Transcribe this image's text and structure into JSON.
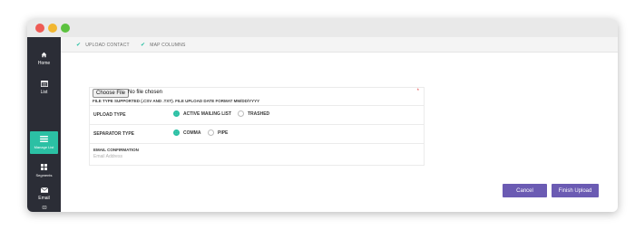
{
  "sidebar": {
    "items": [
      {
        "label": "Home",
        "icon": "home-icon"
      },
      {
        "label": "List",
        "icon": "list-icon"
      },
      {
        "label": "Manage List",
        "icon": "manage-list-icon",
        "active": true
      },
      {
        "label": "Segments",
        "icon": "segments-icon"
      },
      {
        "label": "Email",
        "icon": "email-icon"
      },
      {
        "label": "",
        "icon": "message-icon"
      }
    ]
  },
  "steps": [
    {
      "label": "UPLOAD CONTACT",
      "icon": "check-icon"
    },
    {
      "label": "MAP COLUMNS",
      "icon": "check-icon"
    }
  ],
  "form": {
    "file_button": "Choose File",
    "file_status": "No file chosen",
    "file_hint": "FILE TYPE SUPPORTED (.CSV AND .TXT). FILE UPLOAD DATE FORMAT MM/DD/YYYY",
    "required_marker": "*",
    "upload_type": {
      "label": "UPLOAD TYPE",
      "options": [
        {
          "label": "ACTIVE MAILING LIST",
          "selected": true
        },
        {
          "label": "TRASHED",
          "selected": false
        }
      ]
    },
    "separator_type": {
      "label": "SEPARATOR TYPE",
      "options": [
        {
          "label": "COMMA",
          "selected": true
        },
        {
          "label": "PIPE",
          "selected": false
        }
      ]
    },
    "email_confirmation": {
      "label": "EMAIL CONFIRMATION",
      "placeholder": "Email Address"
    }
  },
  "actions": {
    "cancel": "Cancel",
    "finish": "Finish Upload"
  },
  "colors": {
    "accent": "#2bc0a4",
    "button": "#6b5bb3",
    "sidebar": "#2b2d36",
    "required": "#e03a3a"
  }
}
